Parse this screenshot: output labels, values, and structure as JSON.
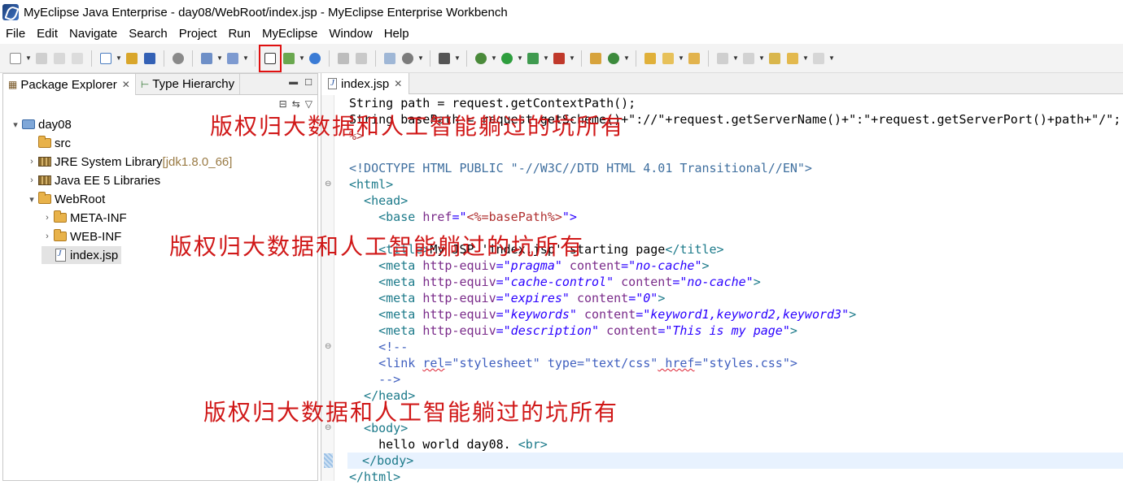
{
  "window": {
    "title": "MyEclipse Java Enterprise - day08/WebRoot/index.jsp - MyEclipse Enterprise Workbench"
  },
  "menu": [
    "File",
    "Edit",
    "Navigate",
    "Search",
    "Project",
    "Run",
    "MyEclipse",
    "Window",
    "Help"
  ],
  "left_panel": {
    "tabs": [
      {
        "label": "Package Explorer",
        "active": true
      },
      {
        "label": "Type Hierarchy",
        "active": false
      }
    ],
    "tree": [
      {
        "label": "day08",
        "extra": "",
        "icon": "project-icon",
        "twisty": "▾"
      },
      {
        "label": "src",
        "extra": "",
        "icon": "package-folder-icon",
        "twisty": ""
      },
      {
        "label": "JRE System Library ",
        "extra": "[jdk1.8.0_66]",
        "icon": "library-icon",
        "twisty": "›"
      },
      {
        "label": "Java EE 5 Libraries",
        "extra": "",
        "icon": "library-icon",
        "twisty": "›"
      },
      {
        "label": "WebRoot",
        "extra": "",
        "icon": "folder-icon",
        "twisty": "▾"
      },
      {
        "label": "META-INF",
        "extra": "",
        "icon": "folder-icon",
        "twisty": "›"
      },
      {
        "label": "WEB-INF",
        "extra": "",
        "icon": "folder-icon",
        "twisty": "›"
      },
      {
        "label": "index.jsp",
        "extra": "",
        "icon": "jsp-file-icon",
        "twisty": ""
      }
    ]
  },
  "editor": {
    "tab_label": "index.jsp",
    "lines": {
      "l1": "String path = request.getContextPath();",
      "l2a": "String basePath = request.getScheme()+\"://\"+request.getServerName()+\":\"+request.getServerPort()+path+\"/\";",
      "l3": "%>",
      "l5": "<!DOCTYPE HTML PUBLIC \"-//W3C//DTD HTML 4.01 Transitional//EN\">",
      "l6": "<html>",
      "l7": "  <head>",
      "l8a": "    <base ",
      "l8b": "href",
      "l8c": "=\"",
      "l8d": "<%=basePath%>",
      "l8e": "\">",
      "l10a": "    <title>",
      "l10b": "My JSP 'index.jsp' starting page",
      "l10c": "</title>",
      "l11a": "    <meta ",
      "l11b": "http-equiv",
      "l11c": "=\"pragma\"",
      "l11d": " content",
      "l11e": "=\"no-cache\"",
      "l11f": ">",
      "l12a": "    <meta ",
      "l12b": "http-equiv",
      "l12c": "=\"cache-control\"",
      "l12d": " content",
      "l12e": "=\"no-cache\"",
      "l12f": ">",
      "l13a": "    <meta ",
      "l13b": "http-equiv",
      "l13c": "=\"expires\"",
      "l13d": " content",
      "l13e": "=\"0\"",
      "l13f": ">",
      "l14a": "    <meta ",
      "l14b": "http-equiv",
      "l14c": "=\"keywords\"",
      "l14d": " content",
      "l14e": "=\"keyword1,keyword2,keyword3\"",
      "l14f": ">",
      "l15a": "    <meta ",
      "l15b": "http-equiv",
      "l15c": "=\"description\"",
      "l15d": " content",
      "l15e": "=\"This is my page\"",
      "l15f": ">",
      "l16": "    <!--",
      "l17a": "    <link ",
      "l17b": "rel",
      "l17c": "=\"stylesheet\"",
      "l17d": " type",
      "l17e": "=\"text/css\"",
      "l17f": " href",
      "l17g": "=\"styles.css\"",
      "l17h": ">",
      "l18": "    -->",
      "l19": "  </head>",
      "l21": "  <body>",
      "l22a": "    hello world day08. ",
      "l22b": "<br>",
      "l23": "  </body>",
      "l24": "</html>"
    }
  },
  "watermarks": [
    "版权归大数据和人工智能躺过的坑所有",
    "版权归大数据和人工智能躺过的坑所有",
    "版权归大数据和人工智能躺过的坑所有"
  ]
}
